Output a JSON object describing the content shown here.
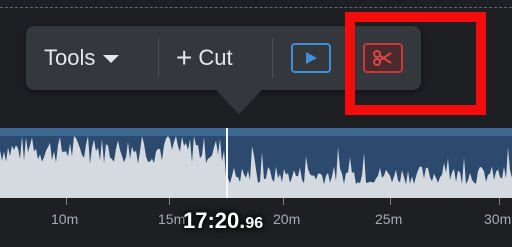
{
  "toolbar": {
    "tools_label": "Tools",
    "cut_label": "Cut",
    "play_icon": "play-icon",
    "scissors_icon": "scissors-icon"
  },
  "timeline": {
    "playhead_time_main": "17:20.",
    "playhead_time_fraction": "96",
    "ticks": [
      {
        "label": "10m"
      },
      {
        "label": "15m"
      },
      {
        "label": "20m"
      },
      {
        "label": "25m"
      },
      {
        "label": "30m"
      }
    ]
  },
  "colors": {
    "highlight": "#f20c0c",
    "play_accent": "#3d8fd8",
    "scissors_accent": "#c83a3a",
    "waveform_fill": "#d5dae0",
    "waveform_background": "#2b4a6d"
  }
}
